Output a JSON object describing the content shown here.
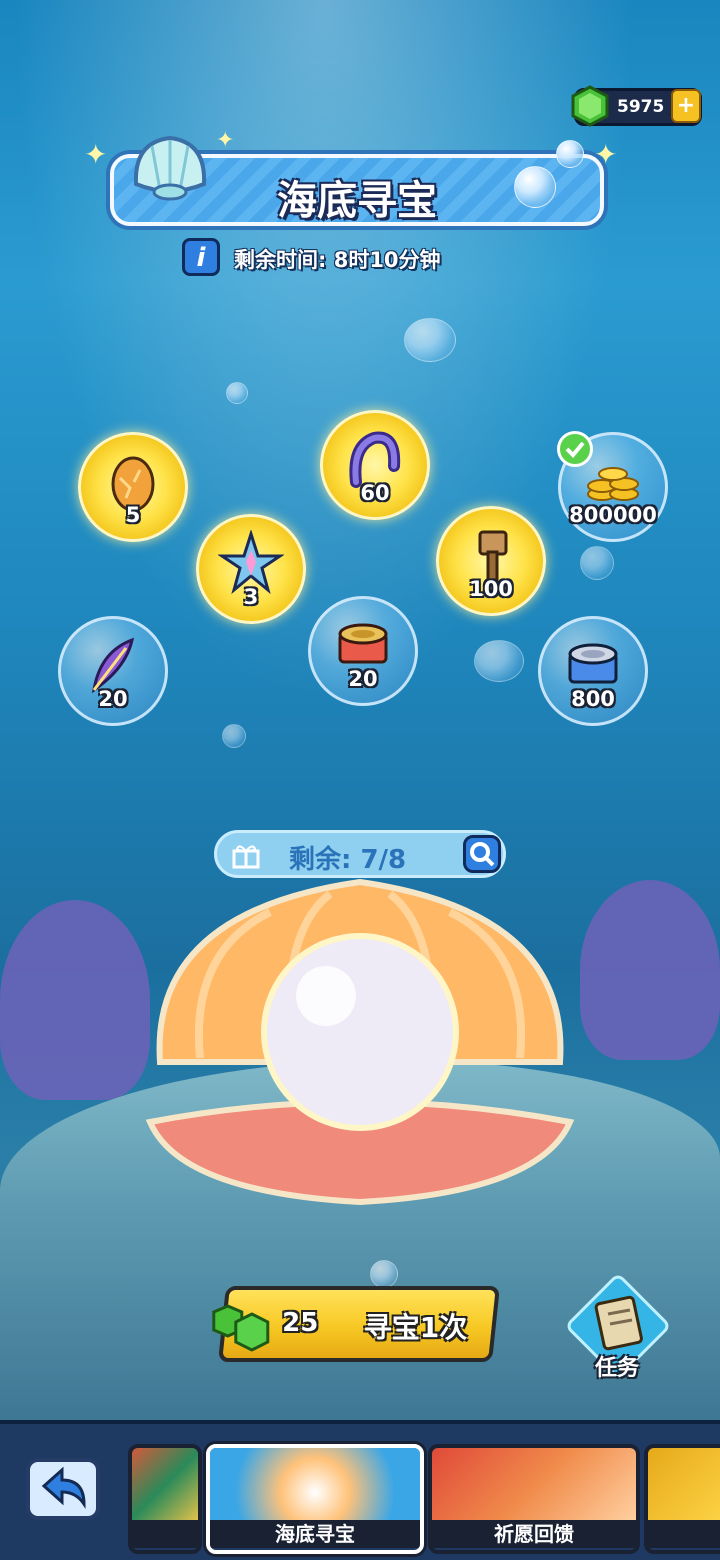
{
  "currency": {
    "value": "5975",
    "plus": "+",
    "icon": "green-gem-icon"
  },
  "header": {
    "title": "海底寻宝",
    "info": "i",
    "timer": "剩余时间: 8时10分钟"
  },
  "rewards": [
    {
      "id": "egg",
      "amount": "5",
      "highlight": "gold",
      "icon": "golden-egg-icon"
    },
    {
      "id": "centipede",
      "amount": "60",
      "highlight": "gold",
      "icon": "purple-creature-icon"
    },
    {
      "id": "coins",
      "amount": "800000",
      "highlight": "none",
      "collected": true,
      "icon": "gold-coins-icon"
    },
    {
      "id": "crystal",
      "amount": "3",
      "highlight": "gold",
      "icon": "crystal-star-icon"
    },
    {
      "id": "hammer",
      "amount": "100",
      "highlight": "gold",
      "icon": "hammer-icon"
    },
    {
      "id": "feather",
      "amount": "20",
      "highlight": "none",
      "icon": "purple-feather-icon"
    },
    {
      "id": "can-red",
      "amount": "20",
      "highlight": "none",
      "icon": "red-cat-food-can-icon"
    },
    {
      "id": "can-blue",
      "amount": "800",
      "highlight": "none",
      "icon": "blue-cat-food-can-icon"
    }
  ],
  "remaining": {
    "text": "剩余: 7/8"
  },
  "hunt": {
    "cost": "25",
    "label": "寻宝1次"
  },
  "tasks": {
    "label": "任务"
  },
  "bottom_nav": {
    "tabs": [
      {
        "label": "海底寻宝",
        "active": true
      },
      {
        "label": "祈愿回馈",
        "active": false
      }
    ]
  },
  "colors": {
    "gold_bubble": "#ffe34a",
    "button_yellow": "#f7c823",
    "title_blue": "#4aa7ea",
    "nav_bg": "#1e3a62"
  }
}
